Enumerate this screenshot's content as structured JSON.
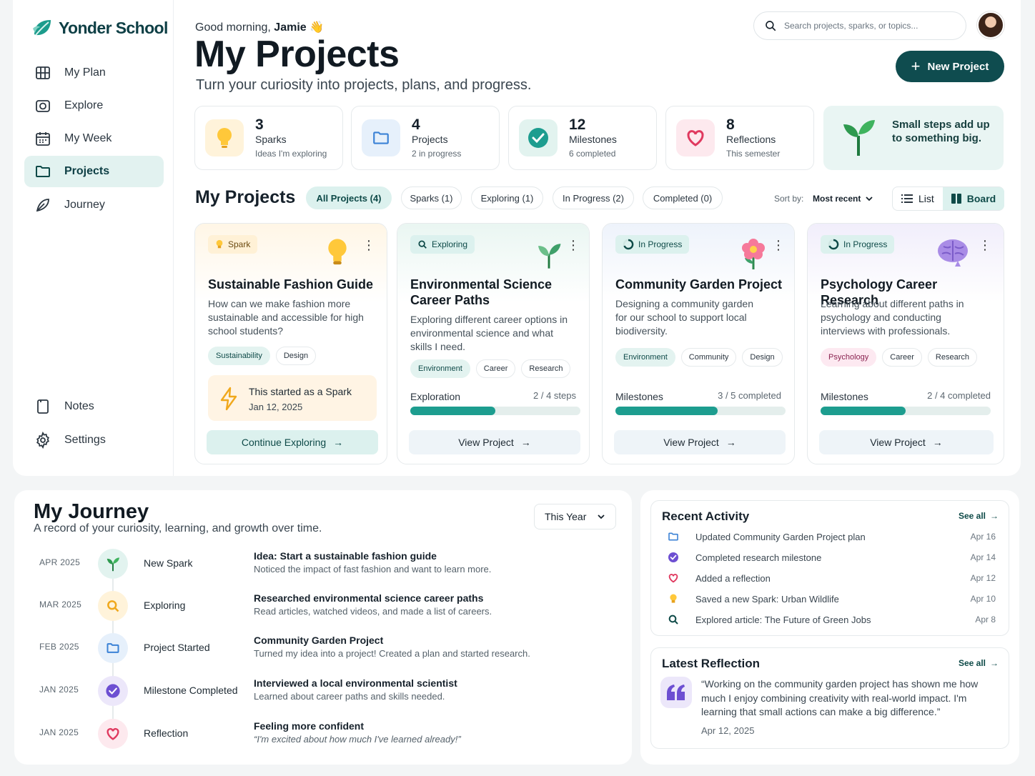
{
  "app": {
    "name": "Yonder School"
  },
  "sidebar": {
    "items": [
      {
        "label": "My Plan",
        "icon": "plan-icon"
      },
      {
        "label": "Explore",
        "icon": "explore-icon"
      },
      {
        "label": "My Week",
        "icon": "calendar-icon"
      },
      {
        "label": "Projects",
        "icon": "folder-icon",
        "active": true
      },
      {
        "label": "Journey",
        "icon": "journey-icon"
      }
    ],
    "bottom": [
      {
        "label": "Notes",
        "icon": "notes-icon"
      },
      {
        "label": "Settings",
        "icon": "gear-icon"
      }
    ]
  },
  "header": {
    "greeting": "Good morning,",
    "user": "Jamie",
    "wave": "👋",
    "title": "My Projects",
    "subtitle": "Turn your curiosity into projects, plans, and progress.",
    "search_placeholder": "Search projects, sparks, or topics...",
    "new_project": "New Project"
  },
  "stats": [
    {
      "num": "3",
      "label": "Sparks",
      "sub": "Ideas I'm exploring",
      "icon": "bulb-icon",
      "color": "#fff3da"
    },
    {
      "num": "4",
      "label": "Projects",
      "sub": "2 in progress",
      "icon": "folder-icon",
      "color": "#e6f0fb"
    },
    {
      "num": "12",
      "label": "Milestones",
      "sub": "6 completed",
      "icon": "check-circle-icon",
      "color": "#e2f3ef"
    },
    {
      "num": "8",
      "label": "Reflections",
      "sub": "This semester",
      "icon": "heart-icon",
      "color": "#fde9ee"
    }
  ],
  "motto": "Small steps add up to something big.",
  "projects_section": {
    "title": "My Projects",
    "filters": [
      "All Projects (4)",
      "Sparks (1)",
      "Exploring (1)",
      "In Progress (2)",
      "Completed (0)"
    ],
    "sort_label": "Sort by:",
    "sort_value": "Most recent",
    "view_list": "List",
    "view_board": "Board"
  },
  "cards": [
    {
      "badge": "Spark",
      "title": "Sustainable Fashion Guide",
      "desc": "How can we make fashion more sustainable and accessible for high school students?",
      "tags": [
        "Sustainability",
        "Design"
      ],
      "note": "This started as a Spark",
      "note_date": "Jan 12, 2025",
      "button": "Continue Exploring"
    },
    {
      "badge": "Exploring",
      "title": "Environmental Science Career Paths",
      "desc": "Exploring different career options in environmental science and what skills I need.",
      "tags": [
        "Environment",
        "Career",
        "Research"
      ],
      "progress_label": "Exploration",
      "progress_text": "2 / 4 steps",
      "progress": 0.5,
      "button": "View Project"
    },
    {
      "badge": "In Progress",
      "title": "Community Garden Project",
      "desc": "Designing a community garden for our school to support local biodiversity.",
      "tags": [
        "Environment",
        "Community",
        "Design"
      ],
      "progress_label": "Milestones",
      "progress_text": "3 / 5 completed",
      "progress": 0.6,
      "button": "View Project"
    },
    {
      "badge": "In Progress",
      "title": "Psychology Career Research",
      "desc": "Learning about different paths in psychology and conducting interviews with professionals.",
      "tags": [
        "Psychology",
        "Career",
        "Research"
      ],
      "progress_label": "Milestones",
      "progress_text": "2 / 4 completed",
      "progress": 0.5,
      "button": "View Project"
    }
  ],
  "journey": {
    "title": "My Journey",
    "subtitle": "A record of your curiosity, learning, and growth over time.",
    "period": "This Year",
    "entries": [
      {
        "date": "APR 2025",
        "kind": "New Spark",
        "title": "Idea: Start a sustainable fashion guide",
        "desc": "Noticed the impact of fast fashion and want to learn more."
      },
      {
        "date": "MAR 2025",
        "kind": "Exploring",
        "title": "Researched environmental science career paths",
        "desc": "Read articles, watched videos, and made a list of careers."
      },
      {
        "date": "FEB 2025",
        "kind": "Project Started",
        "title": "Community Garden Project",
        "desc": "Turned my idea into a project! Created a plan and started research."
      },
      {
        "date": "JAN 2025",
        "kind": "Milestone Completed",
        "title": "Interviewed a local environmental scientist",
        "desc": "Learned about career paths and skills needed."
      },
      {
        "date": "JAN 2025",
        "kind": "Reflection",
        "title": "Feeling more confident",
        "desc": "“I'm excited about how much I've learned already!”"
      }
    ]
  },
  "activity": {
    "title": "Recent Activity",
    "see_all": "See all",
    "items": [
      {
        "text": "Updated Community Garden Project plan",
        "date": "Apr 16"
      },
      {
        "text": "Completed research milestone",
        "date": "Apr 14"
      },
      {
        "text": "Added a reflection",
        "date": "Apr 12"
      },
      {
        "text": "Saved a new Spark: Urban Wildlife",
        "date": "Apr 10"
      },
      {
        "text": "Explored article: The Future of Green Jobs",
        "date": "Apr 8"
      }
    ]
  },
  "reflection": {
    "title": "Latest Reflection",
    "see_all": "See all",
    "quote": "“Working on the community garden project has shown me how much I enjoy combining creativity with real-world impact. I'm learning that small actions can make a big difference.”",
    "date": "Apr 12, 2025"
  }
}
